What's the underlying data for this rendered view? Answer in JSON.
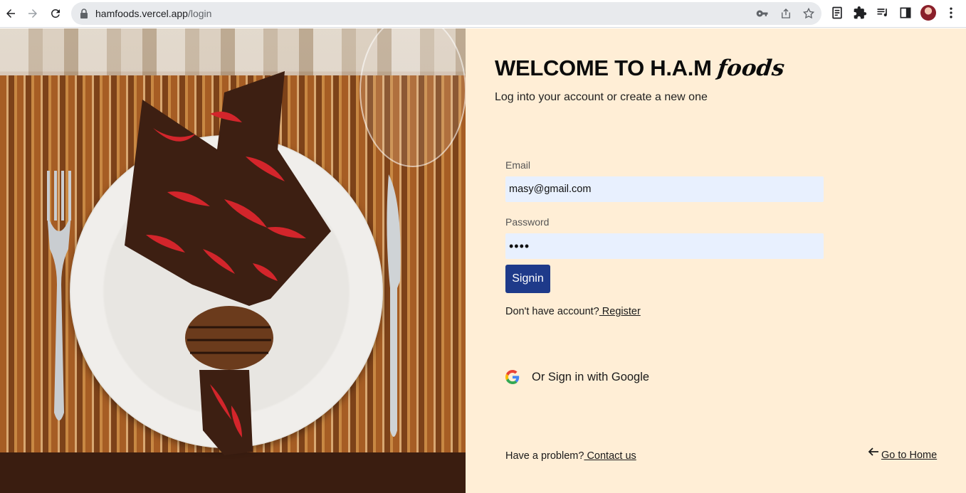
{
  "browser": {
    "url_host": "hamfoods.vercel.app",
    "url_path": "/login"
  },
  "icons": {
    "back": "arrow-left-icon",
    "forward": "arrow-right-icon",
    "reload": "reload-icon",
    "lock": "lock-icon",
    "key": "key-icon",
    "share": "share-icon",
    "bookmark": "star-icon",
    "tab_search": "reading-list-icon",
    "extensions": "puzzle-icon",
    "media": "media-control-icon",
    "side_panel": "side-panel-icon",
    "menu": "kebab-menu-icon",
    "google": "google-logo-icon",
    "home_arrow": "arrow-left-icon"
  },
  "login": {
    "title_main": "WELCOME TO H.A.M",
    "title_script": "foods",
    "subtitle": "Log into your account or create a new one",
    "email_label": "Email",
    "email_value": "masy@gmail.com",
    "password_label": "Password",
    "password_value": "••••",
    "signin_label": "Signin",
    "no_account_text": "Don't have account?",
    "register_link": " Register",
    "google_text": "Or Sign in with Google",
    "problem_text": "Have a problem?",
    "contact_link": " Contact us",
    "home_link": "Go to Home"
  },
  "colors": {
    "panel_bg": "#ffeed6",
    "input_bg": "#e8f0fe",
    "button_bg": "#1e3a8a",
    "button_text": "#ffffff"
  }
}
